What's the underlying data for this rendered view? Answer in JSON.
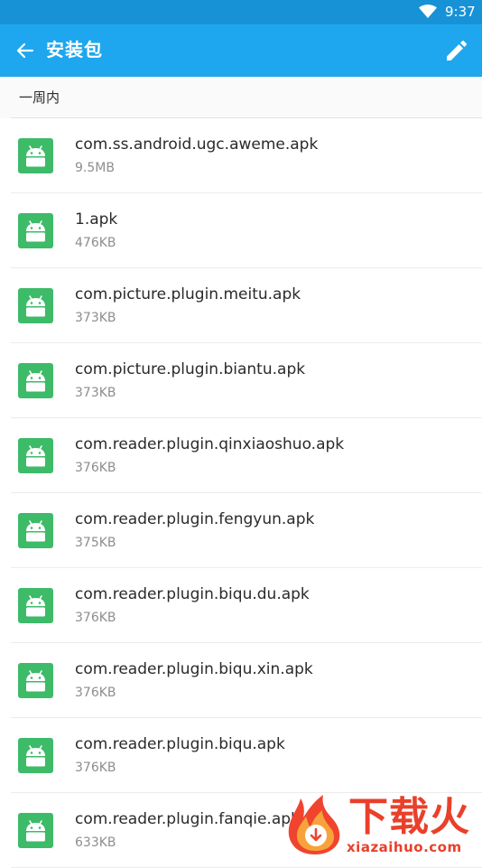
{
  "status_bar": {
    "time": "9:37",
    "wifi_icon": "wifi-icon"
  },
  "app_bar": {
    "title": "安装包",
    "back_icon": "arrow-left-icon",
    "edit_icon": "pencil-icon"
  },
  "section": {
    "label": "一周内"
  },
  "files": [
    {
      "name": "com.ss.android.ugc.aweme.apk",
      "size": "9.5MB"
    },
    {
      "name": "1.apk",
      "size": "476KB"
    },
    {
      "name": "com.picture.plugin.meitu.apk",
      "size": "373KB"
    },
    {
      "name": "com.picture.plugin.biantu.apk",
      "size": "373KB"
    },
    {
      "name": "com.reader.plugin.qinxiaoshuo.apk",
      "size": "376KB"
    },
    {
      "name": "com.reader.plugin.fengyun.apk",
      "size": "375KB"
    },
    {
      "name": "com.reader.plugin.biqu.du.apk",
      "size": "376KB"
    },
    {
      "name": "com.reader.plugin.biqu.xin.apk",
      "size": "376KB"
    },
    {
      "name": "com.reader.plugin.biqu.apk",
      "size": "376KB"
    },
    {
      "name": "com.reader.plugin.fanqie.apl",
      "size": "633KB"
    }
  ],
  "watermark": {
    "brand": "下载火",
    "url": "xiazaihuo.com"
  },
  "colors": {
    "status_bar": "#1892d6",
    "app_bar": "#1ea7ee",
    "apk_icon": "#3dbb68",
    "watermark": "#e9402b"
  }
}
